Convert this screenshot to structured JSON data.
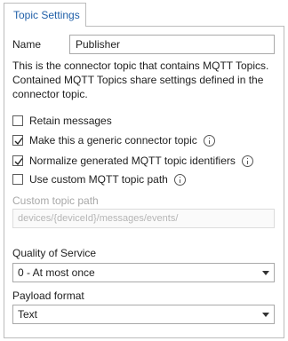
{
  "tab": {
    "label": "Topic Settings"
  },
  "name": {
    "label": "Name",
    "value": "Publisher"
  },
  "description": "This is the connector topic that contains MQTT Topics. Contained MQTT Topics share settings defined in the connector topic.",
  "checkboxes": [
    {
      "label": "Retain messages",
      "checked": false,
      "info": false
    },
    {
      "label": "Make this a generic connector topic",
      "checked": true,
      "info": true
    },
    {
      "label": "Normalize generated MQTT topic identifiers",
      "checked": true,
      "info": true
    },
    {
      "label": "Use custom MQTT topic path",
      "checked": false,
      "info": true
    }
  ],
  "custom_path": {
    "label": "Custom topic path",
    "placeholder": "devices/{deviceId}/messages/events/"
  },
  "qos": {
    "label": "Quality of Service",
    "value": "0 - At most once"
  },
  "payload": {
    "label": "Payload format",
    "value": "Text"
  }
}
